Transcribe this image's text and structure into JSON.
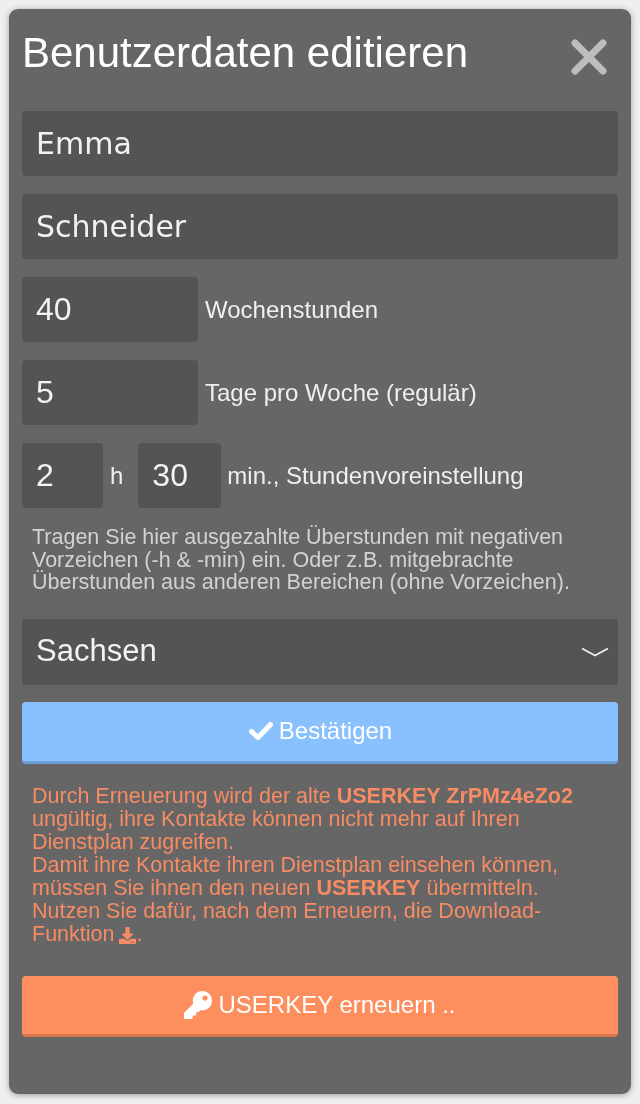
{
  "dialog": {
    "title": "Benutzerdaten editieren"
  },
  "name_fields": [
    {
      "value": "Emma"
    },
    {
      "value": "Schneider"
    }
  ],
  "number_fields": [
    {
      "value": "40",
      "label": "Wochenstunden"
    },
    {
      "value": "5",
      "label": "Tage pro Woche (regulär)"
    }
  ],
  "overtime": {
    "hours": "2",
    "hours_unit": "h",
    "minutes": "30",
    "label": "min., Stundenvoreinstellung"
  },
  "overtime_hint": "Tragen Sie hier ausgezahlte Überstunden mit negativen Vorzeichen (-h & -min) ein. Oder z.B. mitgebrachte Überstunden aus anderen Bereichen (ohne Vorzeichen).",
  "region_select": {
    "value": "Sachsen"
  },
  "confirm_button": {
    "label": "Bestätigen"
  },
  "warning": {
    "paragraphs": [
      "Durch Erneuerung wird der alte **USERKEY ZrPMz4eZo2** ungültig, ihre Kontakte können nicht mehr auf Ihren Dienstplan zugreifen.",
      "Damit ihre Kontakte ihren Dienstplan einsehen können, müssen Sie ihnen den neuen **USERKEY** übermitteln."
    ],
    "download_note": {
      "text": "Nutzen Sie dafür, nach dem Erneuern, die Download-",
      "continuation": "Funktion",
      "end": "."
    }
  },
  "renew_button": {
    "label": "USERKEY erneuern .."
  }
}
